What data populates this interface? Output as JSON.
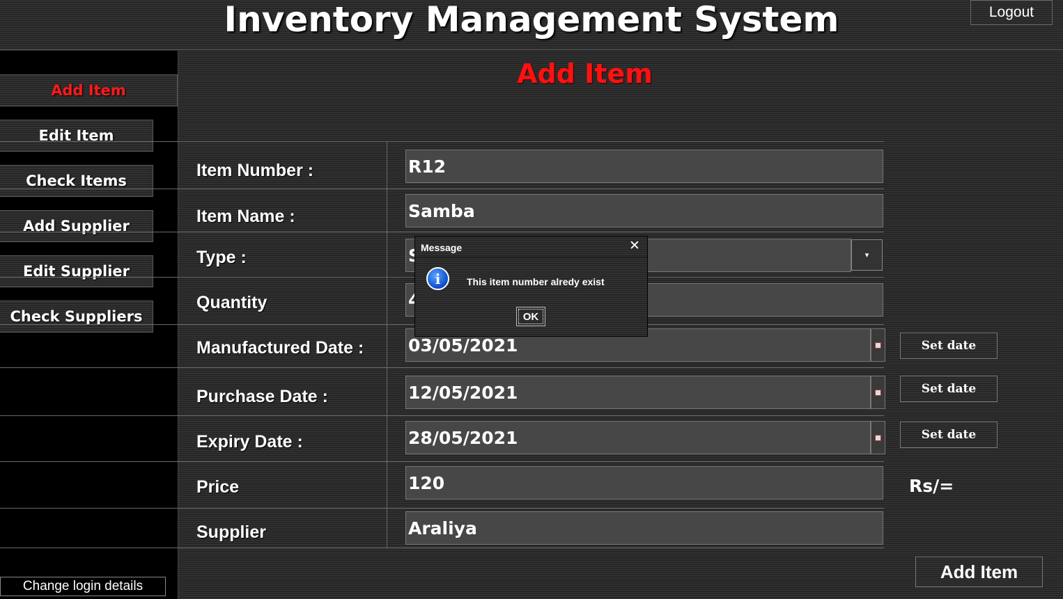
{
  "header": {
    "title": "Inventory Management System",
    "logout_label": "Logout"
  },
  "sidebar": {
    "add_item": "Add Item",
    "edit_item": "Edit Item",
    "check_items": "Check Items",
    "add_supplier": "Add Supplier",
    "edit_supplier": "Edit Supplier",
    "check_suppliers": "Check Suppliers",
    "change_login": "Change login details"
  },
  "main": {
    "title": "Add Item",
    "labels": {
      "item_number": "Item Number :",
      "item_name": "Item Name :",
      "type": "Type :",
      "quantity": "Quantity",
      "manufactured_date": "Manufactured Date :",
      "purchase_date": "Purchase Date :",
      "expiry_date": "Expiry Date :",
      "price": "Price",
      "supplier": "Supplier"
    },
    "values": {
      "item_number": "R12",
      "item_name": "Samba",
      "type": "S",
      "quantity": "4",
      "manufactured_date": "03/05/2021",
      "purchase_date": "12/05/2021",
      "expiry_date": "28/05/2021",
      "price": "120",
      "supplier": "Araliya"
    },
    "set_date_label": "Set date",
    "currency": "Rs/=",
    "add_button": "Add Item"
  },
  "dialog": {
    "title": "Message",
    "message": "This item number alredy exist",
    "ok_label": "OK",
    "close_glyph": "✕",
    "icon": "info-icon"
  },
  "colors": {
    "accent_red": "#ff1111",
    "background": "#2e2e2e",
    "sidebar": "#000000"
  }
}
